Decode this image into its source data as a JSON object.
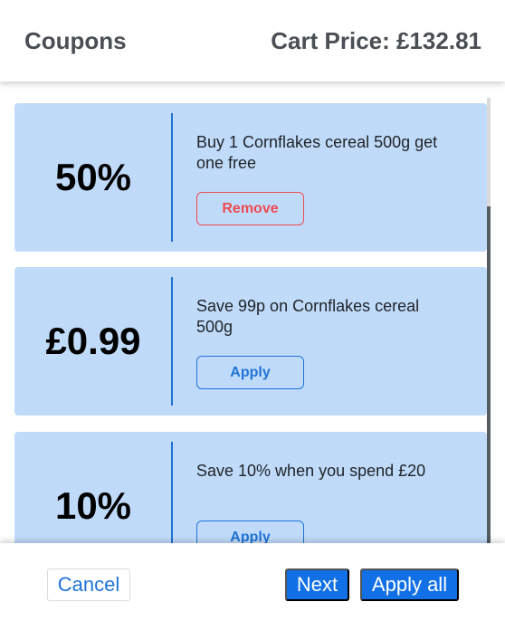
{
  "header": {
    "title": "Coupons",
    "cart_price": "Cart Price: £132.81"
  },
  "coupons": [
    {
      "value": "50%",
      "description": "Buy 1 Cornflakes cereal 500g get one free",
      "action": "Remove"
    },
    {
      "value": "£0.99",
      "description": "Save 99p on Cornflakes cereal 500g",
      "action": "Apply"
    },
    {
      "value": "10%",
      "description": "Save 10% when you spend £20",
      "action": "Apply"
    }
  ],
  "footer": {
    "cancel_label": "Cancel",
    "next_label": "Next",
    "apply_all_label": "Apply all"
  },
  "colors": {
    "coupon_bg": "#c0dbfa",
    "accent": "#1170e6",
    "remove": "#ee4a50"
  }
}
